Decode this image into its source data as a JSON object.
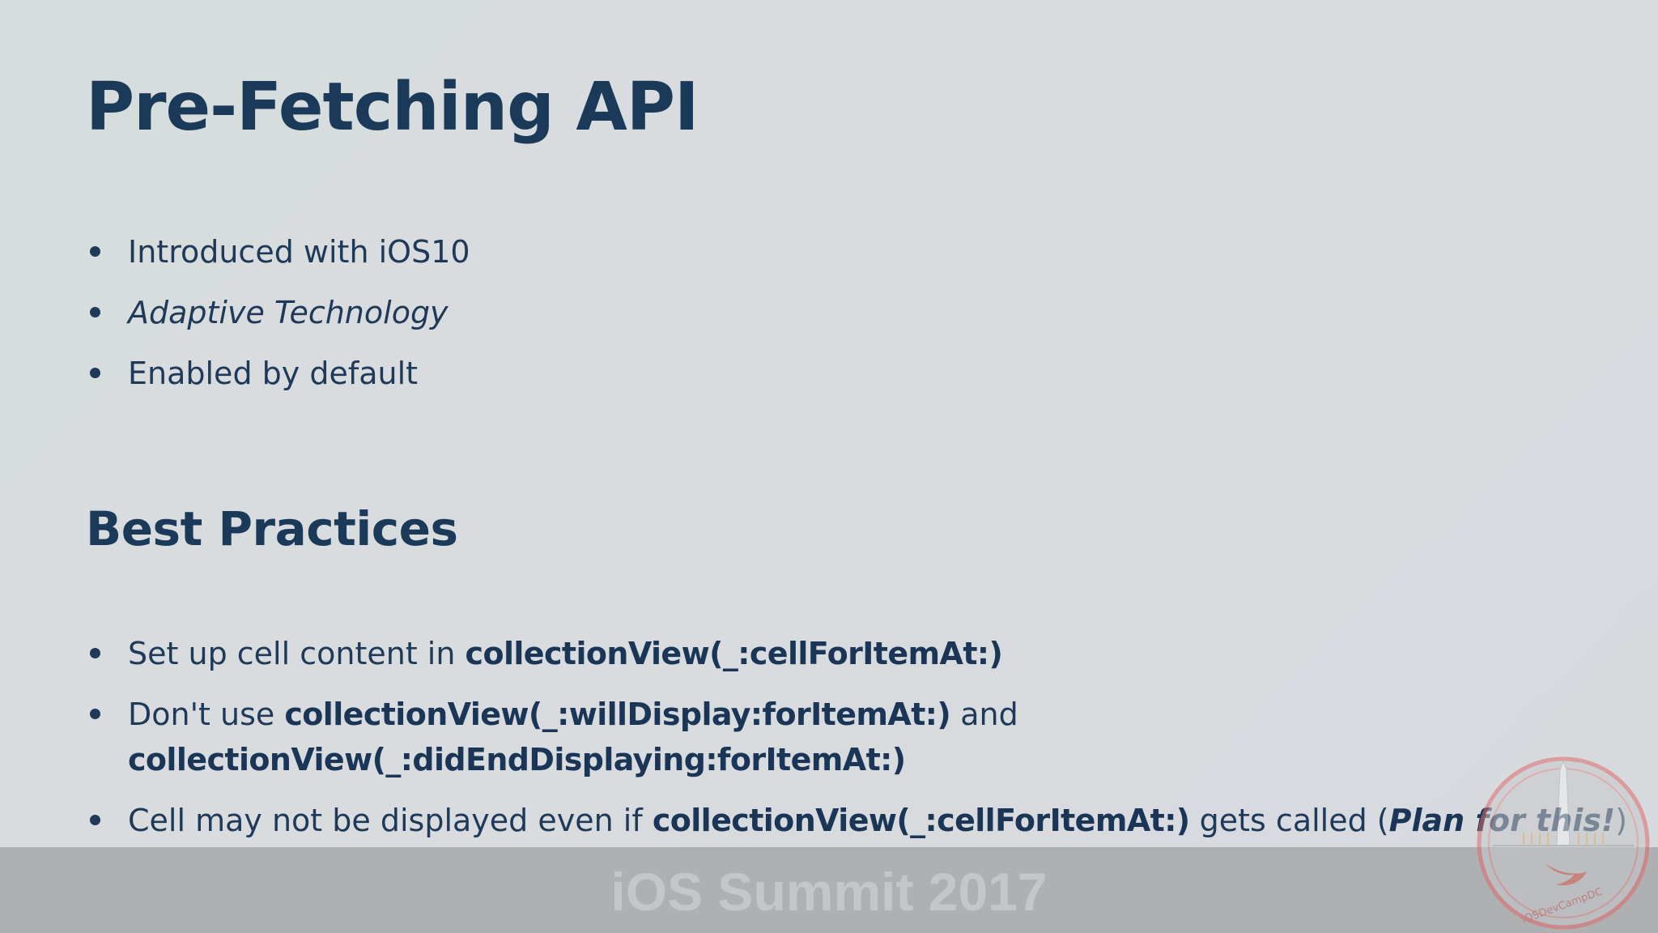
{
  "slide": {
    "title": "Pre-Fetching API",
    "intro_bullets": [
      {
        "text": "Introduced with iOS10"
      },
      {
        "text": "Adaptive Technology"
      },
      {
        "text": "Enabled by default"
      }
    ],
    "subtitle": "Best Practices",
    "practice_bullets": [
      {
        "prefix": "Set up cell content in ",
        "code": "collectionView(_:cellForItemAt:)"
      },
      {
        "prefix": "Don't use ",
        "code": "collectionView(_:willDisplay:forItemAt:)",
        "middle": " and",
        "code_line2": "collectionView(_:didEndDisplaying:forItemAt:)"
      },
      {
        "prefix": "Cell may not be displayed even if ",
        "code": "collectionView(_:cellForItemAt:)",
        "middle": " gets called (",
        "emphasis": "Plan for this!",
        "suffix": ")"
      }
    ]
  },
  "footer": {
    "text": "iOS Summit 2017",
    "logo_text": "iOSDevCampDC"
  },
  "colors": {
    "heading": "#1b3a5a",
    "body": "#1e3a58",
    "footer_bar": "#aeb0b2",
    "footer_text": "#c5c6c8",
    "logo_ring": "#e06a6a"
  }
}
